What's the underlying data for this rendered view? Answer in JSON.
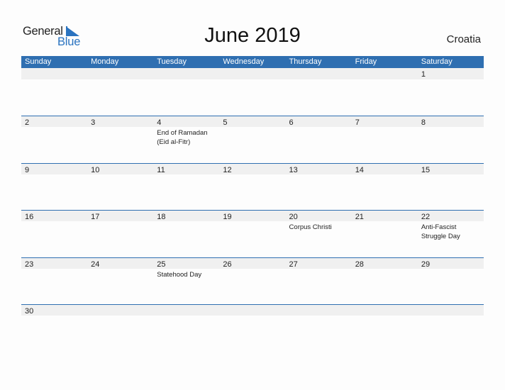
{
  "logo": {
    "line1": "General",
    "line2": "Blue"
  },
  "title": "June 2019",
  "country": "Croatia",
  "colors": {
    "accent": "#2f6fb1",
    "band": "#f0f0f0"
  },
  "weekdays": [
    "Sunday",
    "Monday",
    "Tuesday",
    "Wednesday",
    "Thursday",
    "Friday",
    "Saturday"
  ],
  "weeks": [
    [
      {
        "day": ""
      },
      {
        "day": ""
      },
      {
        "day": ""
      },
      {
        "day": ""
      },
      {
        "day": ""
      },
      {
        "day": ""
      },
      {
        "day": "1"
      }
    ],
    [
      {
        "day": "2"
      },
      {
        "day": "3"
      },
      {
        "day": "4",
        "event": "End of Ramadan (Eid al-Fitr)"
      },
      {
        "day": "5"
      },
      {
        "day": "6"
      },
      {
        "day": "7"
      },
      {
        "day": "8"
      }
    ],
    [
      {
        "day": "9"
      },
      {
        "day": "10"
      },
      {
        "day": "11"
      },
      {
        "day": "12"
      },
      {
        "day": "13"
      },
      {
        "day": "14"
      },
      {
        "day": "15"
      }
    ],
    [
      {
        "day": "16"
      },
      {
        "day": "17"
      },
      {
        "day": "18"
      },
      {
        "day": "19"
      },
      {
        "day": "20",
        "event": "Corpus Christi"
      },
      {
        "day": "21"
      },
      {
        "day": "22",
        "event": "Anti-Fascist Struggle Day"
      }
    ],
    [
      {
        "day": "23"
      },
      {
        "day": "24"
      },
      {
        "day": "25",
        "event": "Statehood Day"
      },
      {
        "day": "26"
      },
      {
        "day": "27"
      },
      {
        "day": "28"
      },
      {
        "day": "29"
      }
    ],
    [
      {
        "day": "30"
      },
      {
        "day": ""
      },
      {
        "day": ""
      },
      {
        "day": ""
      },
      {
        "day": ""
      },
      {
        "day": ""
      },
      {
        "day": ""
      }
    ]
  ]
}
